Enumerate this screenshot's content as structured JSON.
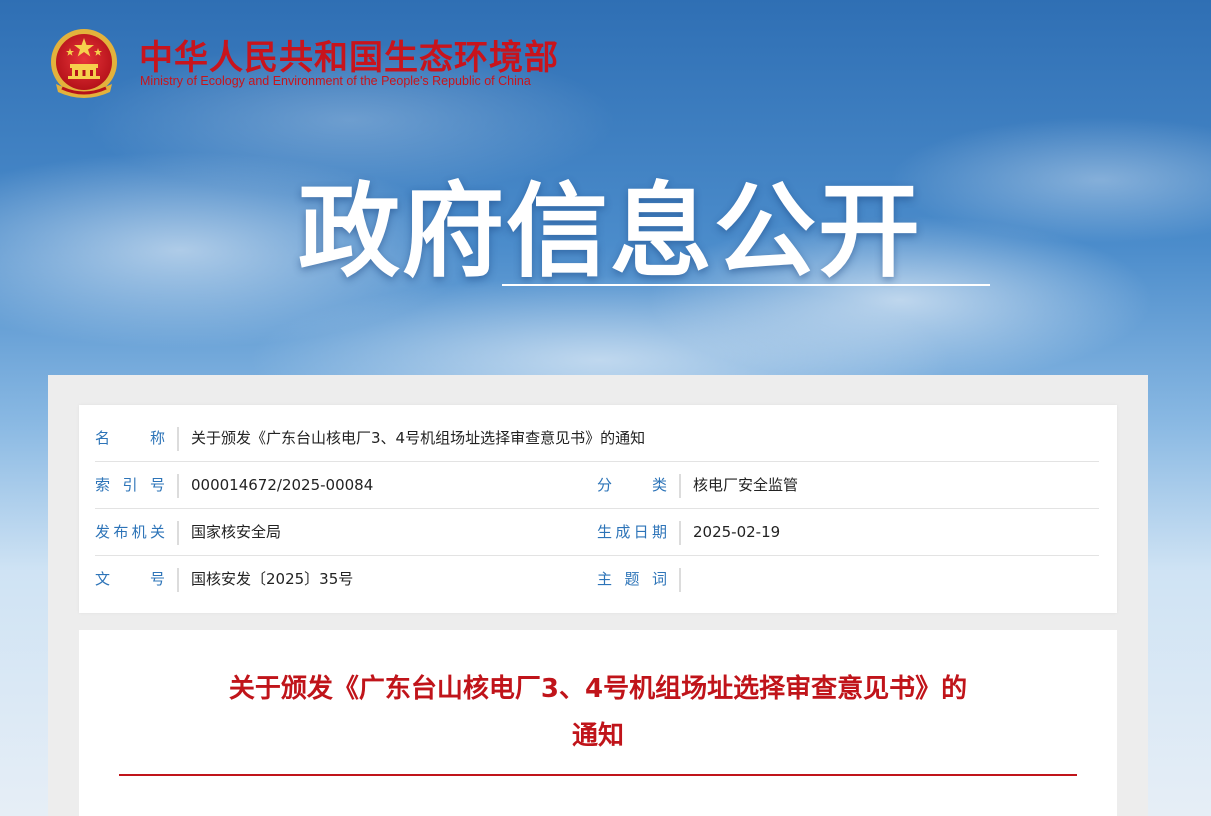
{
  "header": {
    "ministry_cn": "中华人民共和国生态环境部",
    "ministry_en": "Ministry of Ecology and Environment of the People's Republic of China",
    "emblem_icon": "national-emblem-icon"
  },
  "banner": {
    "title": "政府信息公开"
  },
  "meta": {
    "name_label": "名　称",
    "name_value": "关于颁发《广东台山核电厂3、4号机组场址选择审查意见书》的通知",
    "index_label": "索引号",
    "index_value": "000014672/2025-00084",
    "category_label": "分　类",
    "category_value": "核电厂安全监管",
    "issuer_label": "发布机关",
    "issuer_value": "国家核安全局",
    "date_label": "生成日期",
    "date_value": "2025-02-19",
    "docno_label": "文　号",
    "docno_value": "国核安发〔2025〕35号",
    "keywords_label": "主题词",
    "keywords_value": ""
  },
  "document": {
    "title_line1": "关于颁发《广东台山核电厂3、4号机组场址选择审查意见书》的",
    "title_line2": "通知"
  },
  "colors": {
    "brand_red": "#c8141c",
    "label_blue": "#2d74b8",
    "sky_blue": "#3d7fbe"
  }
}
